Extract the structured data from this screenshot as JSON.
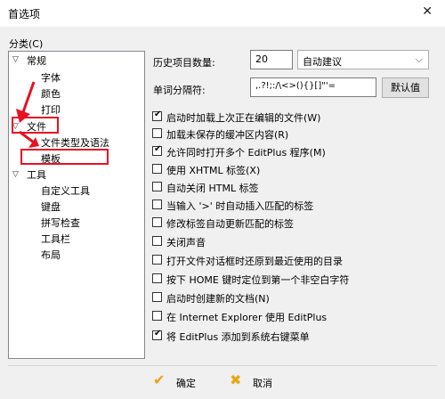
{
  "window": {
    "title": "首选项",
    "close_label": "✕"
  },
  "category": {
    "label": "分类(C)"
  },
  "tree": {
    "nodes": [
      {
        "label": "常规",
        "level": 0,
        "expanded": true
      },
      {
        "label": "字体",
        "level": 1
      },
      {
        "label": "颜色",
        "level": 1
      },
      {
        "label": "打印",
        "level": 1
      },
      {
        "label": "文件",
        "level": 0,
        "expanded": true
      },
      {
        "label": "文件类型及语法",
        "level": 1
      },
      {
        "label": "模板",
        "level": 1
      },
      {
        "label": "工具",
        "level": 0,
        "expanded": true
      },
      {
        "label": "自定义工具",
        "level": 1
      },
      {
        "label": "键盘",
        "level": 1
      },
      {
        "label": "拼写检查",
        "level": 1
      },
      {
        "label": "工具栏",
        "level": 1
      },
      {
        "label": "布局",
        "level": 1
      }
    ]
  },
  "settings": {
    "history_label": "历史项目数量:",
    "history_value": "20",
    "history_mode": "自动建议",
    "wordsep_label": "单词分隔符:",
    "wordsep_value": ",.?!;:/\\<>(){}[]\"'=",
    "default_button": "默认值"
  },
  "checkboxes": [
    {
      "label": "启动时加载上次正在编辑的文件(W)",
      "checked": true
    },
    {
      "label": "加载未保存的缓冲区内容(R)",
      "checked": false
    },
    {
      "label": "允许同时打开多个 EditPlus 程序(M)",
      "checked": true
    },
    {
      "label": "使用 XHTML 标签(X)",
      "checked": false
    },
    {
      "label": "自动关闭 HTML 标签",
      "checked": false
    },
    {
      "label": "当输入 '>' 时自动插入匹配的标签",
      "checked": false
    },
    {
      "label": "修改标签自动更新匹配的标签",
      "checked": false
    },
    {
      "label": "关闭声音",
      "checked": false
    },
    {
      "label": "打开文件对话框时还原到最近使用的目录",
      "checked": false
    },
    {
      "label": "按下 HOME 键时定位到第一个非空白字符",
      "checked": false
    },
    {
      "label": "启动时创建新的文档(N)",
      "checked": false
    },
    {
      "label": "在 Internet Explorer 使用 EditPlus",
      "checked": false
    },
    {
      "label": "将 EditPlus 添加到系统右键菜单",
      "checked": true
    }
  ],
  "footer": {
    "ok_label": "确定",
    "cancel_label": "取消"
  },
  "colors": {
    "annotation": "#e81123",
    "ok_check": "#f39c12",
    "cancel_x": "#e6a817"
  }
}
